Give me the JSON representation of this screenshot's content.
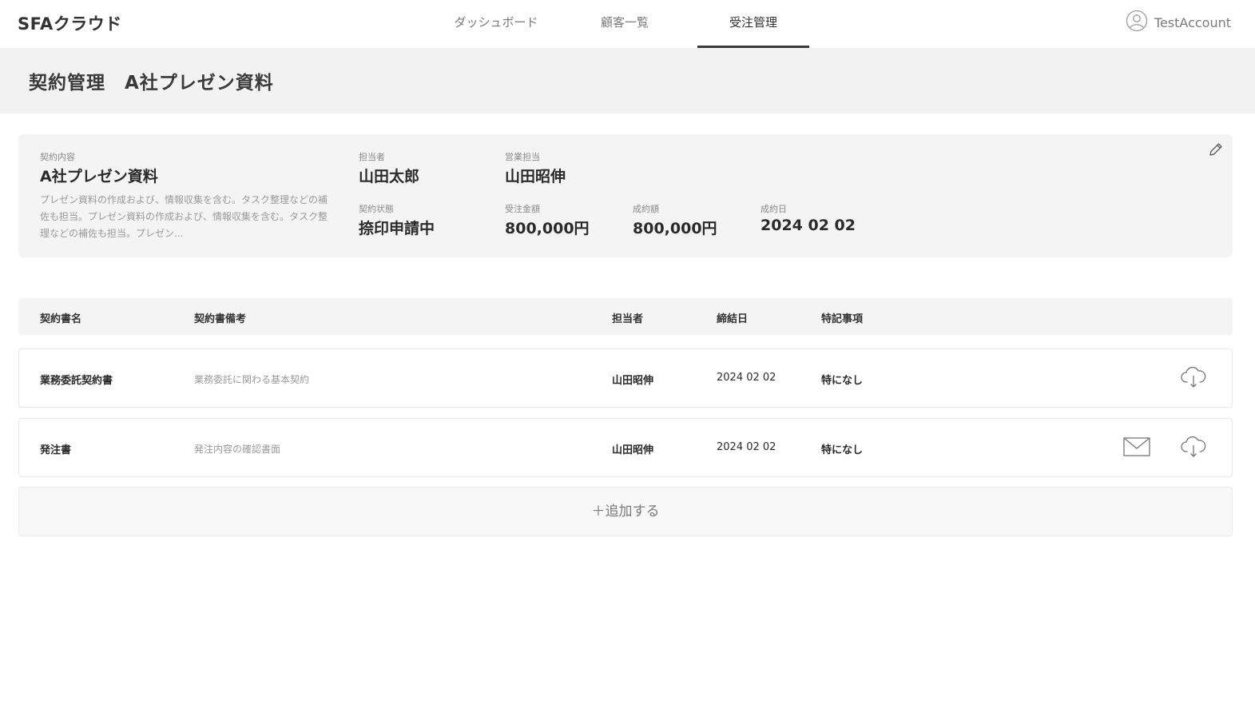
{
  "header": {
    "logo": "SFAクラウド",
    "tabs": [
      {
        "label": "ダッシュボード",
        "active": false
      },
      {
        "label": "顧客一覧",
        "active": false
      },
      {
        "label": "受注管理",
        "active": true
      }
    ],
    "account_label": "TestAccount",
    "account_icon": "user-circle-icon"
  },
  "page": {
    "title": "契約管理　A社プレゼン資料"
  },
  "summary": {
    "content_label": "契約内容",
    "content_title": "A社プレゼン資料",
    "content_desc": "プレゼン資料の作成および、情報収集を含む。タスク整理などの補佐も担当。プレゼン資料の作成および、情報収集を含む。タスク整理などの補佐も担当。プレゼン...",
    "person_label": "担当者",
    "person_value": "山田太郎",
    "sales_label": "営業担当",
    "sales_value": "山田昭伸",
    "status_label": "契約状態",
    "status_value": "捺印申請中",
    "order_amount_label": "受注金額",
    "order_amount_value": "800,000円",
    "contract_amount_label": "成約額",
    "contract_amount_value": "800,000円",
    "contract_date_label": "成約日",
    "contract_date_value": "2024 02 02",
    "edit_icon": "pencil-icon"
  },
  "table": {
    "columns": [
      "契約書名",
      "契約書備考",
      "担当者",
      "締結日",
      "特記事項"
    ],
    "rows": [
      {
        "name": "業務委託契約書",
        "note": "業務委託に関わる基本契約",
        "person": "山田昭伸",
        "date": "2024 02 02",
        "remarks": "特になし",
        "has_mail": false
      },
      {
        "name": "発注書",
        "note": "発注内容の確認書面",
        "person": "山田昭伸",
        "date": "2024 02 02",
        "remarks": "特になし",
        "has_mail": true
      }
    ],
    "add_label": "＋追加する"
  },
  "colors": {
    "title_bar_bg": "#f2f2f2",
    "card_bg": "#f4f4f4",
    "text_primary": "#2a2a2a",
    "text_muted": "#9a9a9a"
  }
}
